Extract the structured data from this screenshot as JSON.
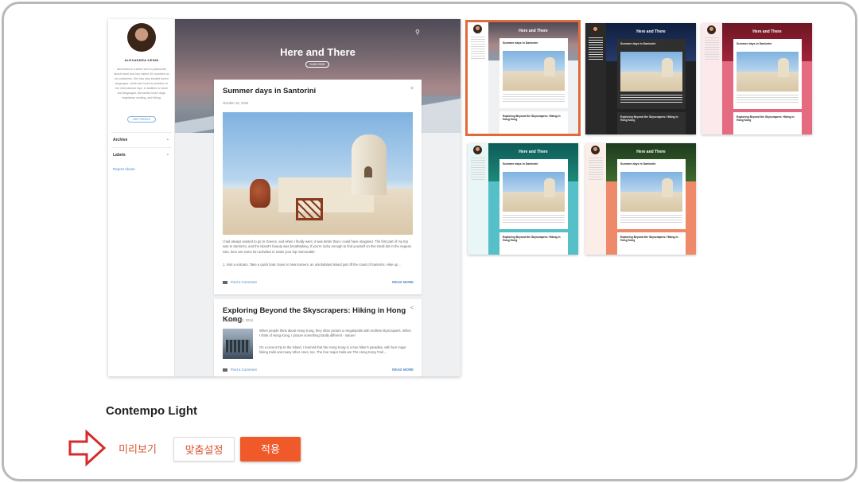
{
  "preview": {
    "blog_title": "Here and There",
    "subscribe_label": "SUBSCRIBE",
    "author_name": "ALEXANDRA KENIN",
    "author_bio": "Alexandra is a writer who is passionate about travel and has visited 40 countries on six continents. She has also studied seven languages, which she loves to practice on her international trips. In addition to travel and languages, Alexandra loves dogs, vegetarian cooking, and hiking.",
    "visit_profile_label": "VISIT PROFILE",
    "sidebar_archive": "Archive",
    "sidebar_labels": "Labels",
    "report_abuse": "Report Abuse",
    "post1": {
      "title": "Summer days in Santorini",
      "date": "October 18, 2016",
      "excerpt1": "I had always wanted to go to Greece, and when I finally went, it was better than I could have imagined. The first part of my trip was to Santorini, and the island's beauty was breathtaking. If you're lucky enough to find yourself on this small dot in the Aegean Sea, here are some fun activities to make your trip memorable:",
      "excerpt2": "1. Visit a volcano. Take a quick boat cruise to Nea Kameni, an uninhabited island just off the coast of Santorini. Hike up ...",
      "comment_label": "Post a Comment",
      "read_more": "READ MORE"
    },
    "post2": {
      "title": "Exploring Beyond the Skyscrapers: Hiking in Hong Kong",
      "date": "September 12, 2016",
      "excerpt1": "When people think about Hong Kong, they often picture a megalopolis with endless skyscrapers. When I think of Hong Kong, I picture something totally different - nature!",
      "excerpt2": "On a recent trip to the island, I learned that the Hong Kong is a true hiker's paradise, with four major hiking trails and many other ones, too. The four major trails are The Hong Kong Trail ...",
      "comment_label": "Post a Comment",
      "read_more": "READ MORE"
    }
  },
  "thumbnails": [
    {
      "title": "Here and There",
      "post1": "Summer days in Santorini",
      "post2": "Exploring Beyond the Skyscrapers: Hiking in Hong Kong",
      "selected": true
    },
    {
      "title": "Here and There",
      "post1": "Summer days in Santorini",
      "post2": "Exploring Beyond the Skyscrapers: Hiking in Hong Kong",
      "selected": false
    },
    {
      "title": "Here and There",
      "post1": "Summer days in Santorini",
      "post2": "Exploring Beyond the Skyscrapers: Hiking in Hong Kong",
      "selected": false
    },
    {
      "title": "Here and There",
      "post1": "Summer days in Santorini",
      "post2": "Exploring Beyond the Skyscrapers: Hiking in Hong Kong",
      "selected": false
    },
    {
      "title": "Here and There",
      "post1": "Summer days in Santorini",
      "post2": "Exploring Beyond the Skyscrapers: Hiking in Hong Kong",
      "selected": false
    }
  ],
  "theme_name": "Contempo Light",
  "buttons": {
    "preview": "미리보기",
    "customize": "맞춤설정",
    "apply": "적용"
  },
  "colors": {
    "accent": "#f05a2a",
    "selected_outline": "#e06a3a",
    "annotation_arrow": "#d62b2b",
    "link": "#4a89c8"
  },
  "icons": [
    "search-icon",
    "share-icon",
    "chevron-down-icon",
    "comment-icon",
    "annotation-arrow-icon"
  ]
}
